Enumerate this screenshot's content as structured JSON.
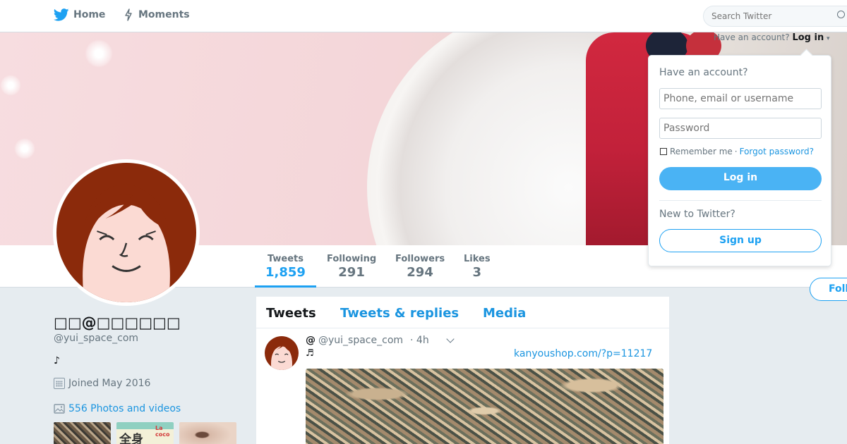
{
  "nav": {
    "home_label": "Home",
    "moments_label": "Moments",
    "search_placeholder": "Search Twitter"
  },
  "account_prompt": {
    "text": "Have an account?",
    "login_label": "Log in"
  },
  "profile": {
    "display_name": "□□@□□□□□□",
    "handle": "@yui_space_com",
    "bio": "♪",
    "joined": "Joined May 2016",
    "photos_label": "556 Photos and videos",
    "thumb2_text": "全身",
    "thumb2_logo": "La coco"
  },
  "stats": [
    {
      "label": "Tweets",
      "value": "1,859"
    },
    {
      "label": "Following",
      "value": "291"
    },
    {
      "label": "Followers",
      "value": "294"
    },
    {
      "label": "Likes",
      "value": "3"
    }
  ],
  "follow_label": "Foll",
  "timeline": {
    "tabs": [
      "Tweets",
      "Tweets & replies",
      "Media"
    ],
    "tweet": {
      "at": "@",
      "handle": "@yui_space_com",
      "time": "· 4h",
      "note": "♬",
      "link": "kanyoushop.com/?p=11217"
    }
  },
  "login_dropdown": {
    "title": "Have an account?",
    "username_placeholder": "Phone, email or username",
    "password_placeholder": "Password",
    "remember": "Remember me",
    "separator": "·",
    "forgot": "Forgot password?",
    "login_button": "Log in",
    "new_prompt": "New to Twitter?",
    "signup_button": "Sign up"
  },
  "colors": {
    "brand_blue": "#1da1f2",
    "link_blue": "#1b95e0",
    "muted": "#66757f",
    "background": "#e6ecf0"
  }
}
